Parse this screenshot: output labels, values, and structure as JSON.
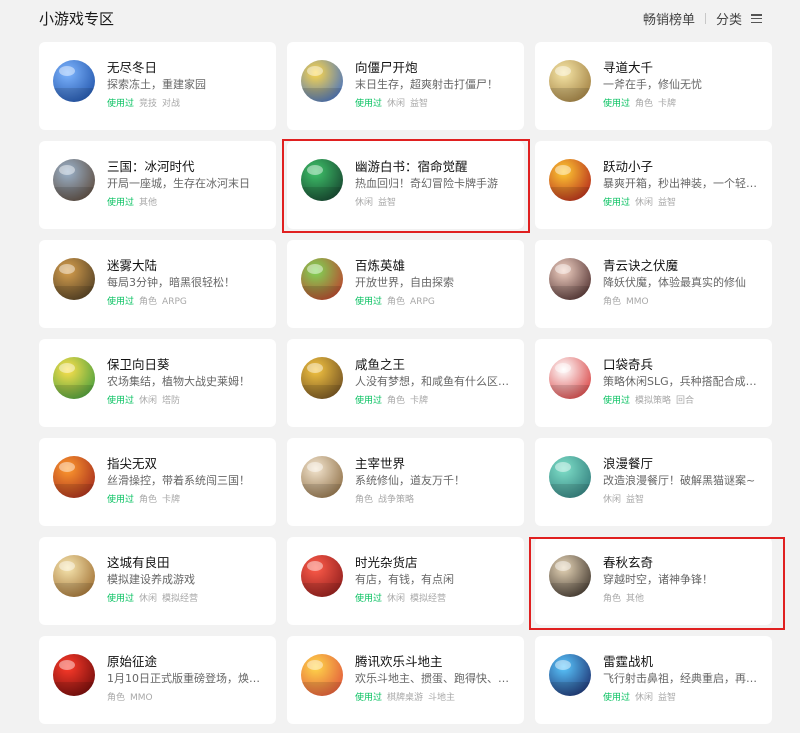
{
  "header": {
    "title": "小游戏专区",
    "bestseller_label": "畅销榜单",
    "category_label": "分类",
    "menu_icon": "menu-icon"
  },
  "colors": {
    "used_green": "#07c160",
    "highlight_red": "#e02020",
    "card_bg": "#ffffff",
    "page_bg": "#f2f2f2"
  },
  "games": [
    {
      "name": "无尽冬日",
      "desc": "探索冻土，重建家园",
      "used": "使用过",
      "tags": [
        "竞技",
        "对战"
      ],
      "icon": "globe-icon",
      "c1": "#7fb6ff",
      "c2": "#1c4fa6"
    },
    {
      "name": "向僵尸开炮",
      "desc": "末日生存，超爽射击打僵尸！",
      "used": "使用过",
      "tags": [
        "休闲",
        "益智"
      ],
      "icon": "zombie-cannon-icon",
      "c1": "#ffd84a",
      "c2": "#3a6bc8"
    },
    {
      "name": "寻道大千",
      "desc": "一斧在手，修仙无忧",
      "used": "使用过",
      "tags": [
        "角色",
        "卡牌"
      ],
      "icon": "axe-cultivator-icon",
      "c1": "#f7e7a8",
      "c2": "#9c7a3c"
    },
    {
      "name": "三国：冰河时代",
      "desc": "开局一座城，生存在冰河末日",
      "used": "使用过",
      "tags": [
        "其他"
      ],
      "icon": "warrior-portrait-icon",
      "c1": "#9bb3cc",
      "c2": "#5a4636"
    },
    {
      "name": "幽游白书：宿命觉醒",
      "desc": "热血回归！奇幻冒险卡牌手游",
      "used": "",
      "tags": [
        "休闲",
        "益智"
      ],
      "icon": "anime-hero-icon",
      "c1": "#3fc46a",
      "c2": "#143d2c"
    },
    {
      "name": "跃动小子",
      "desc": "暴爽开箱，秒出神装，一个轻…",
      "used": "使用过",
      "tags": [
        "休闲",
        "益智"
      ],
      "icon": "knight-helmet-icon",
      "c1": "#ffcc33",
      "c2": "#b1201a"
    },
    {
      "name": "迷雾大陆",
      "desc": "每局3分钟，暗黑很轻松！",
      "used": "使用过",
      "tags": [
        "角色",
        "ARPG"
      ],
      "icon": "warrior-icon",
      "c1": "#d8a04e",
      "c2": "#4a3a22"
    },
    {
      "name": "百炼英雄",
      "desc": "开放世界，自由探索",
      "used": "使用过",
      "tags": [
        "角色",
        "ARPG"
      ],
      "icon": "hero-character-icon",
      "c1": "#7ed957",
      "c2": "#c0392b"
    },
    {
      "name": "青云诀之伏魔",
      "desc": "降妖伏魔，体验最真实的修仙",
      "used": "",
      "tags": [
        "角色",
        "MMO"
      ],
      "icon": "fairy-portrait-icon",
      "c1": "#f2d2c4",
      "c2": "#4a2a2a"
    },
    {
      "name": "保卫向日葵",
      "desc": "农场集结，植物大战史莱姆！",
      "used": "使用过",
      "tags": [
        "休闲",
        "塔防"
      ],
      "icon": "sunflower-icon",
      "c1": "#ffe14d",
      "c2": "#3c9a3c"
    },
    {
      "name": "咸鱼之王",
      "desc": "人没有梦想，和咸鱼有什么区…",
      "used": "使用过",
      "tags": [
        "角色",
        "卡牌"
      ],
      "icon": "salted-fish-icon",
      "c1": "#f5c542",
      "c2": "#6a4a20"
    },
    {
      "name": "口袋奇兵",
      "desc": "策略休闲SLG，兵种搭配合成…",
      "used": "使用过",
      "tags": [
        "模拟策略",
        "回合"
      ],
      "icon": "pocket-troops-icon",
      "c1": "#ffffff",
      "c2": "#d63a3a"
    },
    {
      "name": "指尖无双",
      "desc": "丝滑操控，带着系统闯三国！",
      "used": "使用过",
      "tags": [
        "角色",
        "卡牌"
      ],
      "icon": "three-kingdoms-hero-icon",
      "c1": "#ff9a2e",
      "c2": "#a0261c"
    },
    {
      "name": "主宰世界",
      "desc": "系统修仙，道友万千！",
      "used": "",
      "tags": [
        "角色",
        "战争策略"
      ],
      "icon": "immortal-portrait-icon",
      "c1": "#f4e6d0",
      "c2": "#8a6a40"
    },
    {
      "name": "浪漫餐厅",
      "desc": "改造浪漫餐厅！破解黑猫谜案~",
      "used": "",
      "tags": [
        "休闲",
        "益智"
      ],
      "icon": "restaurant-girl-icon",
      "c1": "#7fe0c9",
      "c2": "#2f7a7a"
    },
    {
      "name": "这城有良田",
      "desc": "模拟建设养成游戏",
      "used": "使用过",
      "tags": [
        "休闲",
        "模拟经营"
      ],
      "icon": "farmland-icon",
      "c1": "#f7e6b0",
      "c2": "#9c6a2c"
    },
    {
      "name": "时光杂货店",
      "desc": "有店，有钱，有点闲",
      "used": "使用过",
      "tags": [
        "休闲",
        "模拟经营"
      ],
      "icon": "grocery-store-icon",
      "c1": "#ff5c4a",
      "c2": "#8a1a1a"
    },
    {
      "name": "春秋玄奇",
      "desc": "穿越时空，诸神争锋！",
      "used": "",
      "tags": [
        "角色",
        "其他"
      ],
      "icon": "ancient-warrior-icon",
      "c1": "#e7d6b8",
      "c2": "#3a3028"
    },
    {
      "name": "原始征途",
      "desc": "1月10日正式版重磅登场，焕新…",
      "used": "",
      "tags": [
        "角色",
        "MMO"
      ],
      "icon": "primal-journey-icon",
      "c1": "#ff3b2a",
      "c2": "#6a0a0a"
    },
    {
      "name": "腾讯欢乐斗地主",
      "desc": "欢乐斗地主、掼蛋、跑得快、…",
      "used": "使用过",
      "tags": [
        "棋牌桌游",
        "斗地主"
      ],
      "icon": "doudizhu-farmer-icon",
      "c1": "#ffd84a",
      "c2": "#e0503a"
    },
    {
      "name": "雷霆战机",
      "desc": "飞行射击鼻祖，经典重启，再…",
      "used": "使用过",
      "tags": [
        "休闲",
        "益智"
      ],
      "icon": "fighter-jet-icon",
      "c1": "#5ac8ff",
      "c2": "#1a2a6a"
    }
  ]
}
